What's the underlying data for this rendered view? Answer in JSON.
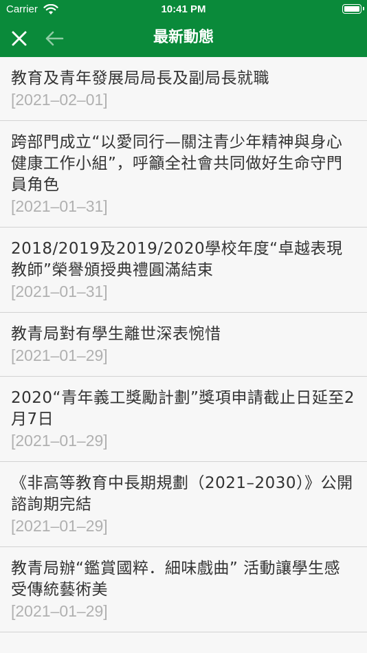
{
  "status_bar": {
    "carrier": "Carrier",
    "time": "10:41 PM"
  },
  "nav": {
    "title": "最新動態",
    "close_icon": "close-icon",
    "back_icon": "arrow-left-icon"
  },
  "colors": {
    "header": "#0a8a3a",
    "date": "#b0b0b0",
    "title": "#333333"
  },
  "news": [
    {
      "title": "教育及青年發展局局長及副局長就職",
      "date": "[2021–02–01]"
    },
    {
      "title": "跨部門成立“以愛同行—關注青少年精神與身心健康工作小組”，呼籲全社會共同做好生命守門員角色",
      "date": "[2021–01–31]"
    },
    {
      "title": "2018/2019及2019/2020學校年度“卓越表現教師”榮譽頒授典禮圓滿結束",
      "date": "[2021–01–31]"
    },
    {
      "title": "教青局對有學生離世深表惋惜",
      "date": "[2021–01–29]"
    },
    {
      "title": "2020“青年義工獎勵計劃”獎項申請截止日延至2月7日",
      "date": "[2021–01–29]"
    },
    {
      "title": "《非高等教育中長期規劃（2021–2030）》公開諮詢期完結",
      "date": "[2021–01–29]"
    },
    {
      "title": "教青局辦“鑑賞國粹．細味戲曲” 活動讓學生感受傳統藝術美",
      "date": "[2021–01–29]"
    }
  ]
}
